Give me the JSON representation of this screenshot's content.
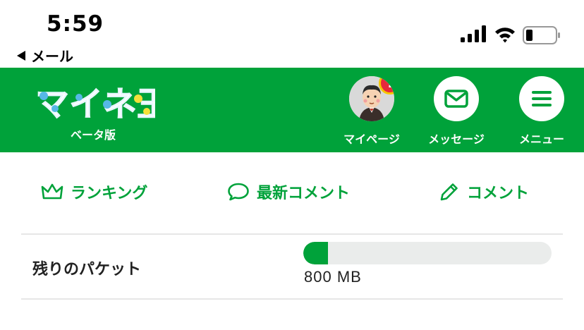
{
  "status_bar": {
    "time": "5:59",
    "back_label": "メール",
    "icons": [
      "cellular-signal-icon",
      "wifi-icon",
      "battery-icon"
    ]
  },
  "header": {
    "logo_text": "マイネ王",
    "beta_label": "ベータ版",
    "nav": [
      {
        "label": "マイページ",
        "icon": "avatar",
        "badge": "!"
      },
      {
        "label": "メッセージ",
        "icon": "envelope-icon"
      },
      {
        "label": "メニュー",
        "icon": "hamburger-icon"
      }
    ]
  },
  "subnav": [
    {
      "label": "ランキング",
      "icon": "crown-icon"
    },
    {
      "label": "最新コメント",
      "icon": "speech-bubble-icon"
    },
    {
      "label": "コメント",
      "icon": "pencil-icon"
    }
  ],
  "packet": {
    "label": "残りのパケット",
    "value": "800 MB",
    "fill_fraction": 0.1
  },
  "colors": {
    "brand_green": "#00a23a",
    "bar_track": "#eaeceb",
    "alert_red": "#e8283c",
    "alert_ring": "#f7c600"
  }
}
